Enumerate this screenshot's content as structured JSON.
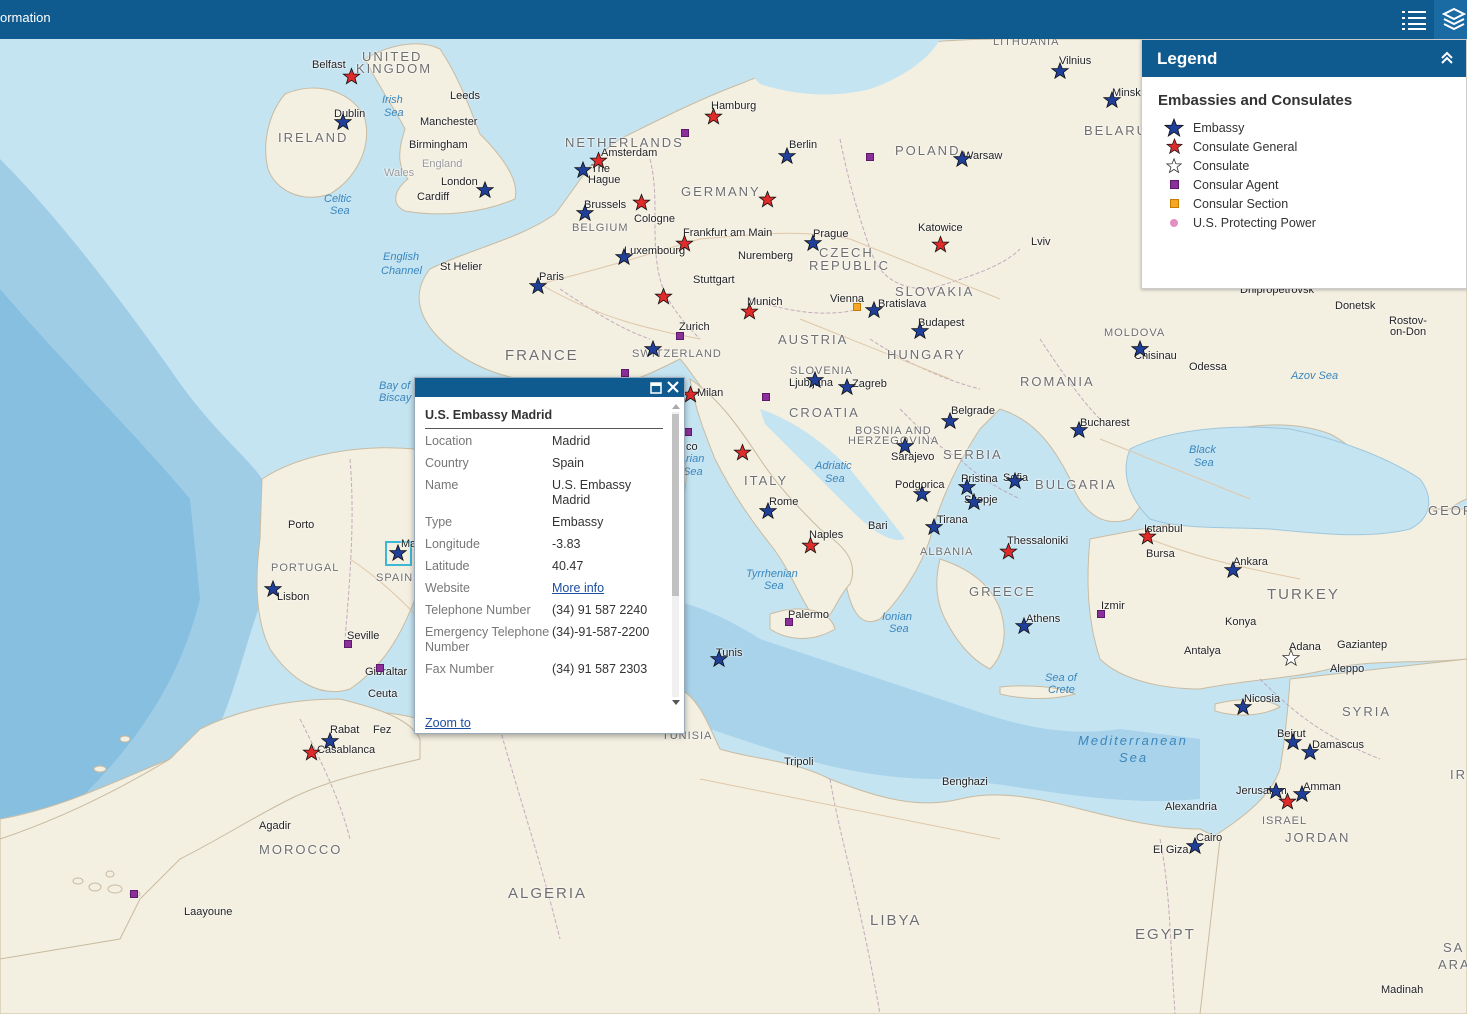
{
  "header": {
    "title": "ormation"
  },
  "legend": {
    "title": "Legend",
    "subtitle": "Embassies and Consulates",
    "items": [
      {
        "label": "Embassy",
        "symbol": "star-blue"
      },
      {
        "label": "Consulate General",
        "symbol": "star-red"
      },
      {
        "label": "Consulate",
        "symbol": "star-white"
      },
      {
        "label": "Consular Agent",
        "symbol": "square-purple"
      },
      {
        "label": "Consular Section",
        "symbol": "square-orange"
      },
      {
        "label": "U.S. Protecting Power",
        "symbol": "dot-pink"
      }
    ]
  },
  "popup": {
    "title": "U.S. Embassy Madrid",
    "fields": [
      {
        "key": "Location",
        "value": "Madrid"
      },
      {
        "key": "Country",
        "value": "Spain"
      },
      {
        "key": "Name",
        "value": "U.S. Embassy Madrid"
      },
      {
        "key": "Type",
        "value": "Embassy"
      },
      {
        "key": "Longitude",
        "value": "-3.83"
      },
      {
        "key": "Latitude",
        "value": "40.47"
      },
      {
        "key": "Website",
        "value": "More info"
      },
      {
        "key": "Telephone Number",
        "value": "(34) 91 587 2240"
      },
      {
        "key": "Emergency Telephone Number",
        "value": "(34)-91-587-2200"
      },
      {
        "key": "Fax Number",
        "value": "(34) 91 587 2303"
      }
    ],
    "zoom_label": "Zoom to"
  },
  "colors": {
    "header": "#0f5a8f",
    "embassy": "#1f3f99",
    "consulate_general": "#e02b2b",
    "consular_agent": "#8b2f9a",
    "consular_section": "#f5a623",
    "protecting_power": "#e48fc2",
    "sea": "#c5e4f2",
    "land": "#f3efe1"
  },
  "map": {
    "labels": {
      "countries": [
        "UNITED",
        "KINGDOM",
        "IRELAND",
        "NETHERLANDS",
        "BELGIUM",
        "GERMANY",
        "POLAND",
        "LITHUANIA",
        "BELARUS",
        "CZECH",
        "REPUBLIC",
        "SLOVAKIA",
        "AUSTRIA",
        "HUNGARY",
        "FRANCE",
        "SWITZERLAND",
        "SLOVENIA",
        "CROATIA",
        "BOSNIA AND",
        "HERZEGOVINA",
        "SERBIA",
        "ROMANIA",
        "MOLDOVA",
        "BULGARIA",
        "ITALY",
        "ALBANIA",
        "GREECE",
        "TURKEY",
        "SYRIA",
        "ISRAEL",
        "JORDAN",
        "PORTUGAL",
        "SPAIN",
        "MOROCCO",
        "ALGERIA",
        "TUNISIA",
        "LIBYA",
        "EGYPT",
        "GEOR",
        "IRA",
        "SA",
        "ARA"
      ],
      "waters": [
        "Irish",
        "Sea",
        "Celtic",
        "English",
        "Channel",
        "Bay of",
        "Biscay",
        "Adriatic",
        "Tyrrhenian",
        "Ionian",
        "Black",
        "Azov Sea",
        "Sea of",
        "Crete",
        "Mediterranean",
        "rian"
      ],
      "cities": [
        "Belfast",
        "Dublin",
        "Leeds",
        "Manchester",
        "Birmingham",
        "England",
        "Wales",
        "London",
        "Cardiff",
        "St Helier",
        "Amsterdam",
        "The",
        "Hague",
        "Brussels",
        "Cologne",
        "Hamburg",
        "Berlin",
        "Warsaw",
        "Vilnius",
        "Minsk",
        "Frankfurt am Main",
        "Luxembourg",
        "Paris",
        "Stuttgart",
        "Nuremberg",
        "Prague",
        "Katowice",
        "Lviv",
        "Munich",
        "Vienna",
        "Bratislava",
        "Budapest",
        "Zurich",
        "Milan",
        "Ljubljana",
        "Zagreb",
        "Belgrade",
        "Sarajevo",
        "Podgorica",
        "Pristina",
        "Sofia",
        "Skopje",
        "Tirana",
        "Thessaloniki",
        "Athens",
        "Bucharest",
        "Chisinau",
        "Odessa",
        "Dnipropetrovsk",
        "Donetsk",
        "Rostov-",
        "on-Don",
        "Istanbul",
        "Bursa",
        "Ankara",
        "Izmir",
        "Konya",
        "Antalya",
        "Adana",
        "Gaziantep",
        "Aleppo",
        "Nicosia",
        "Beirut",
        "Damascus",
        "Jerusalem",
        "Amman",
        "Alexandria",
        "Cairo",
        "El Giza",
        "Madinah",
        "Benghazi",
        "Tripoli",
        "Tunis",
        "Palermo",
        "Naples",
        "Rome",
        "Bari",
        "Porto",
        "Lisbon",
        "Seville",
        "Gibraltar",
        "Ceuta",
        "Rabat",
        "Fez",
        "Casablanca",
        "Agadir",
        "Laayoune",
        "co",
        "Ma"
      ]
    }
  }
}
